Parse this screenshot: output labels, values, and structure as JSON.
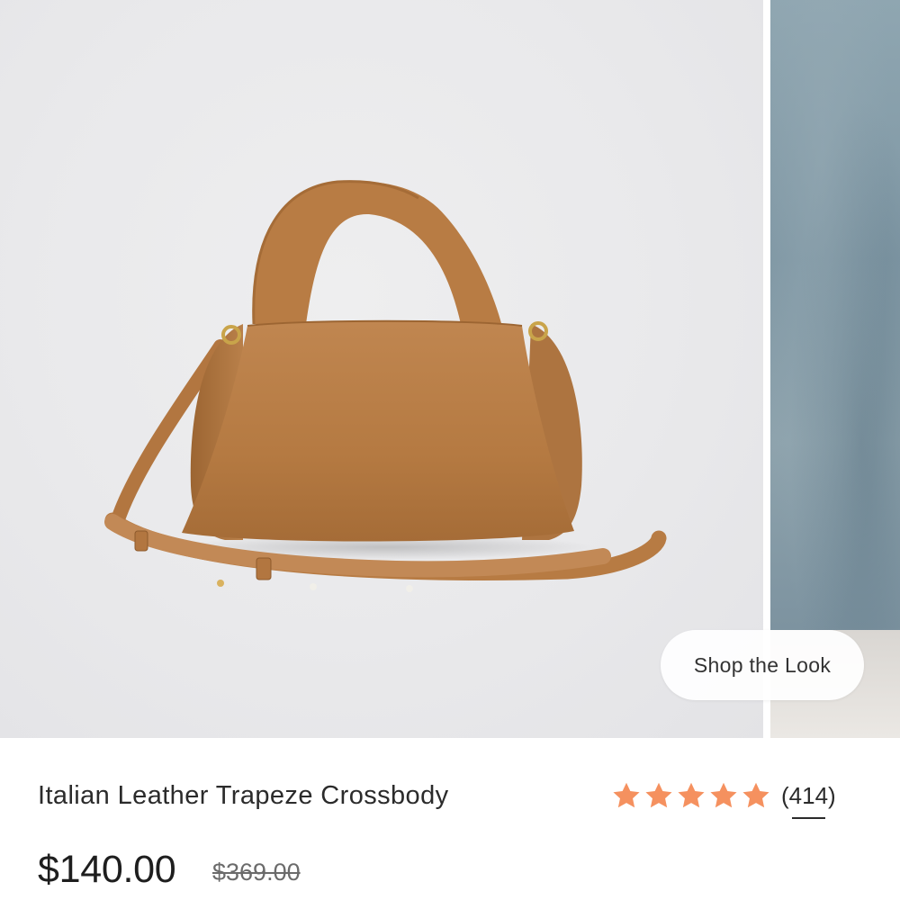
{
  "carousel": {
    "main_image": "tan-pebbled-leather-handbag-photo",
    "next_image": "blue-gray-wall-photo",
    "shop_the_look_label": "Shop the Look"
  },
  "product": {
    "title": "Italian Leather Trapeze Crossbody",
    "rating_value": 5,
    "rating_max": 5,
    "review_count_label": "(414)",
    "price": "$140.00",
    "original_price": "$369.00"
  },
  "colors": {
    "star": "#f5915f",
    "leather": "#b97d44",
    "price_text": "#1e1e1e"
  }
}
